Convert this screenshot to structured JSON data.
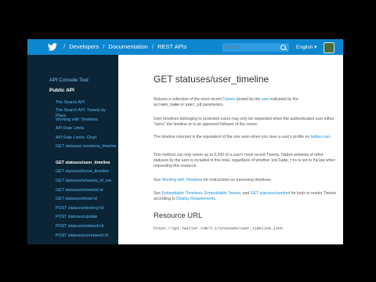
{
  "topbar": {
    "crumbs": [
      "Developers",
      "Documentation",
      "REST APIs"
    ],
    "search_placeholder": "Search",
    "language": "English",
    "colors": {
      "bar": "#0e86cf",
      "sidebar": "#0b2536",
      "link": "#1a8fd9"
    }
  },
  "sidebar": {
    "heading": "API Console Tool",
    "section": "Public API",
    "items": [
      "The Search API",
      "The Search API: Tweets by Place",
      "Working with Timelines",
      "API Rate Limits",
      "API Rate Limits: Chart",
      "GET statuses/ mentions_timeline",
      "GET statuses/user_timeline",
      "GET statuses/home_timeline",
      "GET statuses/retweets_of_me",
      "GET statuses/retweets/:id",
      "GET statuses/show/:id",
      "POST statuses/destroy/:id",
      "POST statuses/update",
      "POST statuses/retweet/:id",
      "POST statuses/unretweet/:id"
    ],
    "active_index": 6
  },
  "main": {
    "title": "GET statuses/user_timeline",
    "p1": {
      "a": "Returns a collection of the most recent ",
      "l1": "Tweets",
      "b": " posted by the ",
      "l2": "user",
      "c": " indicated by the",
      "code1": "screen_name",
      "d": " or ",
      "code2": "user_id",
      "e": " parameters."
    },
    "p2": "User timelines belonging to protected users may only be requested when the authenticated user either \"owns\" the timeline or is an approved follower of the owner.",
    "p3": {
      "a": "The timeline returned is the equivalent of the one seen when you view a user's profile on ",
      "l1": "twitter.com",
      "b": "."
    },
    "p4": {
      "a": "This method can only return up to 3,200 of a user's most recent Tweets. Native retweets of other statuses by the user is included in this total, regardless of whether ",
      "code1": "include_rts",
      "b": " is set to ",
      "code2": "false",
      "c": " when requesting this resource."
    },
    "p5": {
      "a": "See ",
      "l1": "Working with Timelines",
      "b": " for instructions on traversing timelines."
    },
    "p6": {
      "a": "See ",
      "l1": "Embeddable Timelines",
      "b": ", ",
      "l2": "Embeddable Tweets",
      "c": ", and ",
      "l3": "GET statuses/oembed",
      "d": " for tools to render Tweets according to ",
      "l4": "Display Requirements",
      "e": "."
    },
    "resource_heading": "Resource URL",
    "resource_url": "https://api.twitter.com/1.1/statuses/user_timeline.json"
  }
}
